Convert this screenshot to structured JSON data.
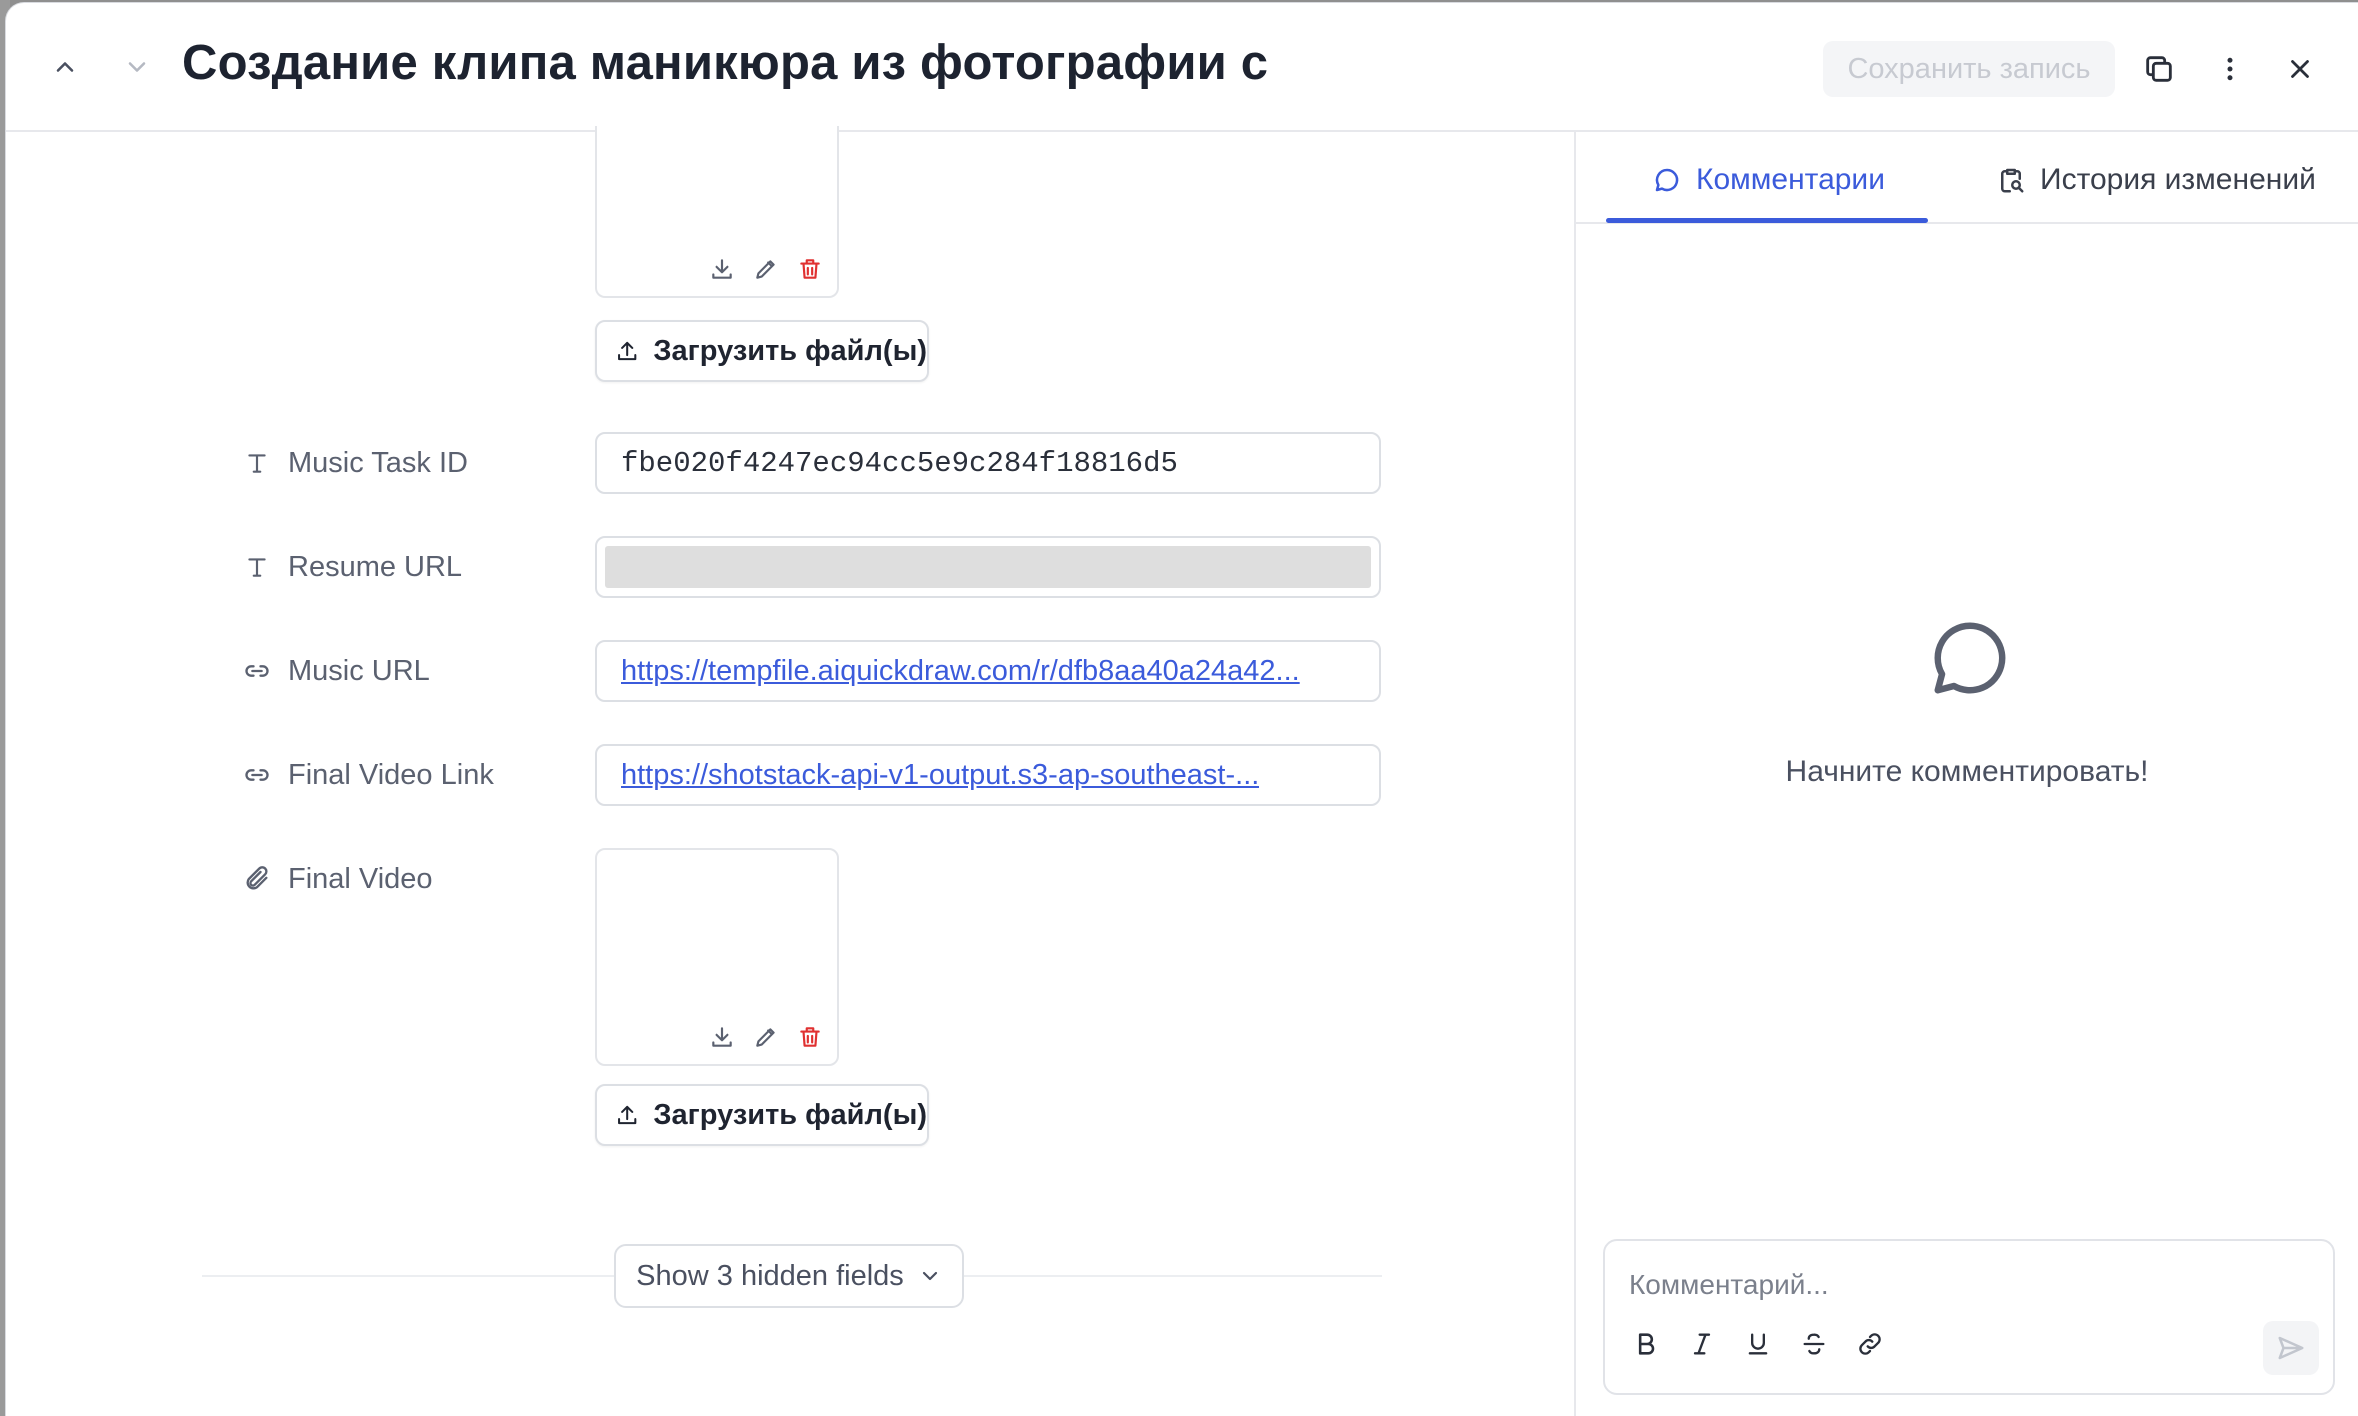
{
  "header": {
    "title": "Создание клипа маникюра из фотографии с",
    "save_label": "Сохранить запись"
  },
  "upload_label": "Загрузить файл(ы)",
  "fields": {
    "music_task_id": {
      "label": "Music Task ID",
      "value": "fbe020f4247ec94cc5e9c284f18816d5"
    },
    "resume_url": {
      "label": "Resume URL",
      "value": ""
    },
    "music_url": {
      "label": "Music URL",
      "value": "https://tempfile.aiquickdraw.com/r/dfb8aa40a24a42..."
    },
    "final_video_link": {
      "label": "Final Video Link",
      "value": "https://shotstack-api-v1-output.s3-ap-southeast-..."
    },
    "final_video": {
      "label": "Final Video"
    }
  },
  "show_hidden_label": "Show 3 hidden fields",
  "sidebar": {
    "tabs": [
      {
        "label": "Комментарии",
        "icon": "chat-bubble-icon",
        "active": true
      },
      {
        "label": "История изменений",
        "icon": "clipboard-search-icon",
        "active": false
      }
    ],
    "empty_text": "Начните комментировать!",
    "comment_placeholder": "Комментарий..."
  },
  "colors": {
    "accent": "#3b5bdb",
    "danger": "#e03131"
  }
}
